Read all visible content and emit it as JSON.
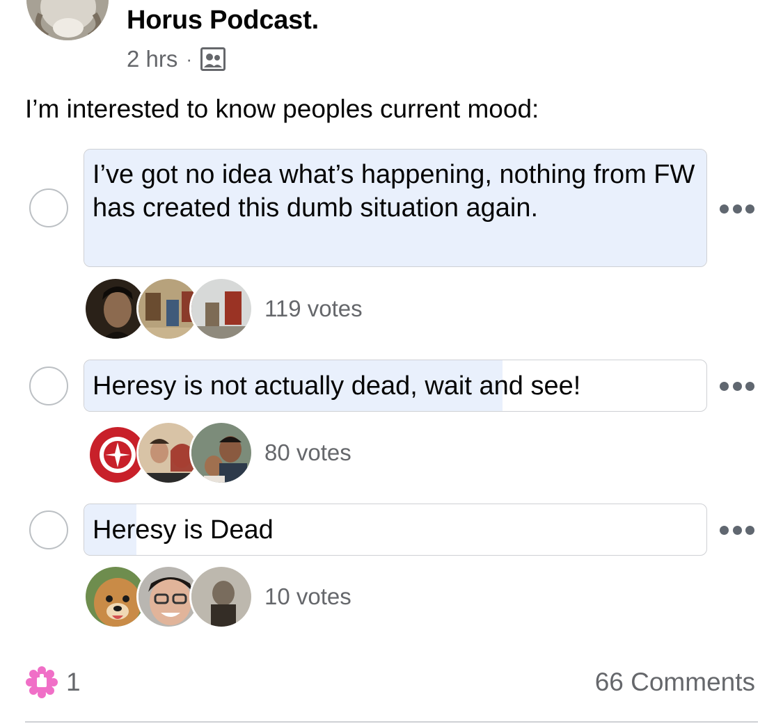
{
  "post": {
    "group_name": "Horus Podcast.",
    "time": "2 hrs",
    "separator": "·",
    "audience_icon": "group-audience-icon",
    "text": "I’m interested to know peoples current mood:"
  },
  "poll": {
    "options": [
      {
        "label": "I’ve got no idea what’s happening, nothing from FW has created this dumb situation again.",
        "votes_label": "119 votes",
        "votes": 119,
        "fill_fraction": 1.0
      },
      {
        "label": "Heresy is not actually dead, wait and see!",
        "votes_label": "80 votes",
        "votes": 80,
        "fill_fraction": 0.672
      },
      {
        "label": "Heresy is Dead",
        "votes_label": "10 votes",
        "votes": 10,
        "fill_fraction": 0.084
      }
    ]
  },
  "footer": {
    "reaction_icon": "care-reaction-icon",
    "reaction_count": "1",
    "comments": "66 Comments"
  },
  "colors": {
    "poll_fill": "#e9f0fc",
    "secondary_text": "#65676b",
    "reaction_pink": "#f06fc7"
  }
}
